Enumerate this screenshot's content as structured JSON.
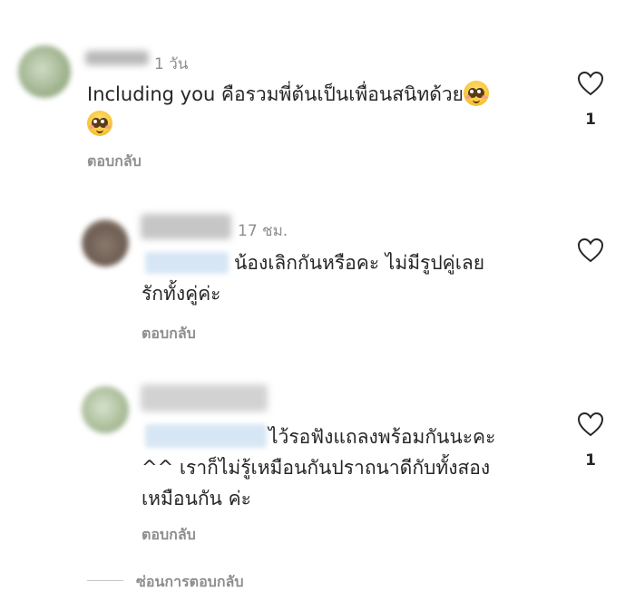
{
  "comments": [
    {
      "time": "1 วัน",
      "line1": "Including you คือรวมพี่ต้นเป็นเพื่อนสนิทด้วย",
      "likes": "1",
      "reply": "ตอบกลับ",
      "emoji": "pleading-face"
    },
    {
      "time": "17 ชม.",
      "line1": "น้องเลิกกันหรือคะ ไม่มีรูปคู่เลย",
      "line2": "รักทั้งคู่ค่ะ",
      "reply": "ตอบกลับ"
    },
    {
      "line1": "ไว้รอฟังแถลงพร้อมกันนะคะ",
      "line2": "^^ เราก็ไม่รู้เหมือนกันปราถนาดีกับทั้งสอง",
      "line3": "เหมือนกัน ค่ะ",
      "likes": "1",
      "reply": "ตอบกลับ"
    }
  ],
  "hide_replies": "ซ่อนการตอบกลับ",
  "colors": {
    "text": "#262626",
    "secondary": "#8e8e8e",
    "heart_outline": "#262626",
    "mention_blur": "#d7e6f4"
  }
}
